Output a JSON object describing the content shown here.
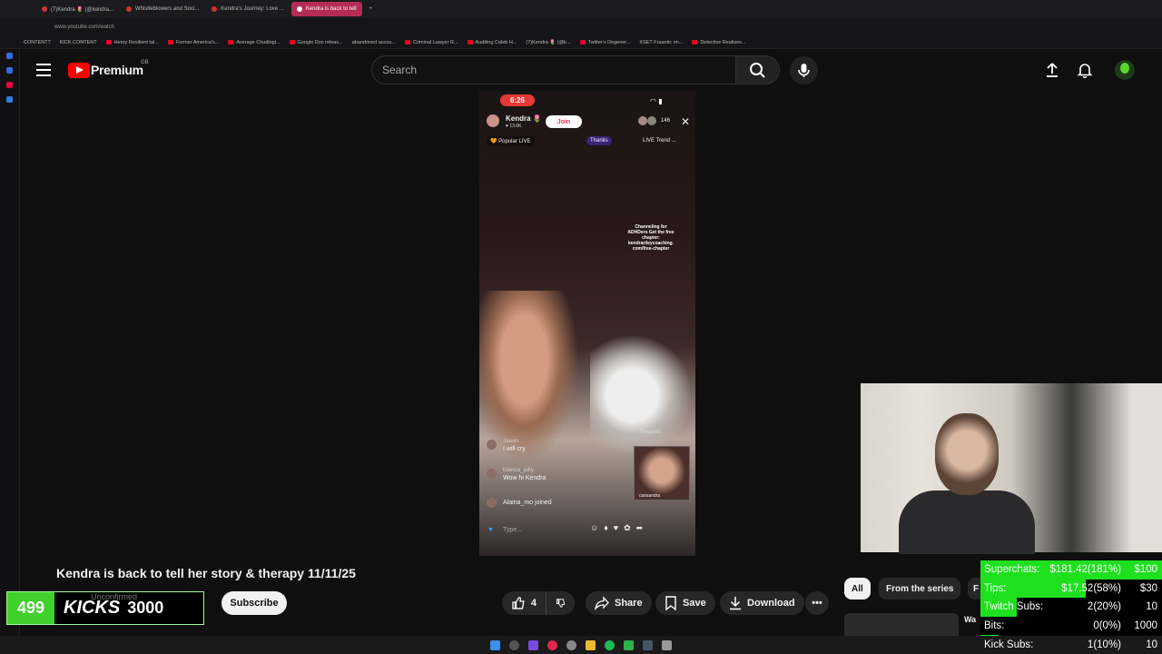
{
  "browser": {
    "tabs": [
      {
        "label": "(7)Kendra 🌷 (@kendra..."
      },
      {
        "label": "Whistleblowers and Soci..."
      },
      {
        "label": "Kendra's Journey: Love ..."
      },
      {
        "label": "Kendra is back to tell"
      }
    ],
    "url": "www.youtube.com/watch",
    "bookmarks": [
      "CONTENT?",
      "KICK CONTENT",
      "Henry Resilient tal...",
      "Former America's...",
      "Average Chudlogi...",
      "Google Doc releas...",
      "abandoned accou...",
      "Criminal Lawyer R...",
      "Auditing Caleb H...",
      "(7)Kendra 🌷 (@k...",
      "Twitter's Degener...",
      "XSET Fraantic on...",
      "Detective Realizes..."
    ]
  },
  "youtube": {
    "logo_text": "Premium",
    "region": "GB",
    "search_placeholder": "Search"
  },
  "video": {
    "time": "6:26",
    "host_name": "Kendra 🌷",
    "host_likes": "♥ 13.6K",
    "join_label": "Join",
    "viewers": "146",
    "popular_live": "🧡 Popular LIVE",
    "thanks": "Thanks",
    "live_trend": "LIVE Trend ...",
    "overlay_text": "Channeling for ADHDers\nGet the free chapter: kendrarileycoaching. com/free-chapter",
    "comments": [
      {
        "user": "Jason",
        "text": "I will cry"
      },
      {
        "user": "bianca_jelly",
        "text": "Wow hi Kendra"
      }
    ],
    "joined": "Alaina_mo joined",
    "request": "Request",
    "guest": "cassandra",
    "type_placeholder": "Type..."
  },
  "title": "Kendra is back to tell her story & therapy 11/11/25",
  "kicks": {
    "count": "499",
    "label": "KICKS",
    "goal": "3000"
  },
  "channel_status": "Unconfirmed",
  "subscribe_label": "Subscribe",
  "actions": {
    "likes": "4",
    "share": "Share",
    "save": "Save",
    "download": "Download"
  },
  "chips": {
    "all": "All",
    "series": "From the series",
    "partial": "F"
  },
  "side_video_title": "Wa",
  "stats": [
    {
      "label": "Superchats:",
      "value": "$181.42(181%)",
      "goal": "$100",
      "percent": 100
    },
    {
      "label": "Tips:",
      "value": "$17.52(58%)",
      "goal": "$30",
      "percent": 58
    },
    {
      "label": "Twitch Subs:",
      "value": "2(20%)",
      "goal": "10",
      "percent": 20
    },
    {
      "label": "Bits:",
      "value": "0(0%)",
      "goal": "1000",
      "percent": 0
    },
    {
      "label": "Kick Subs:",
      "value": "1(10%)",
      "goal": "10",
      "percent": 10
    }
  ],
  "colors": {
    "stat_bar": "#1ee01e",
    "youtube_red": "#ff0000",
    "kick_green": "#3fd02c"
  }
}
